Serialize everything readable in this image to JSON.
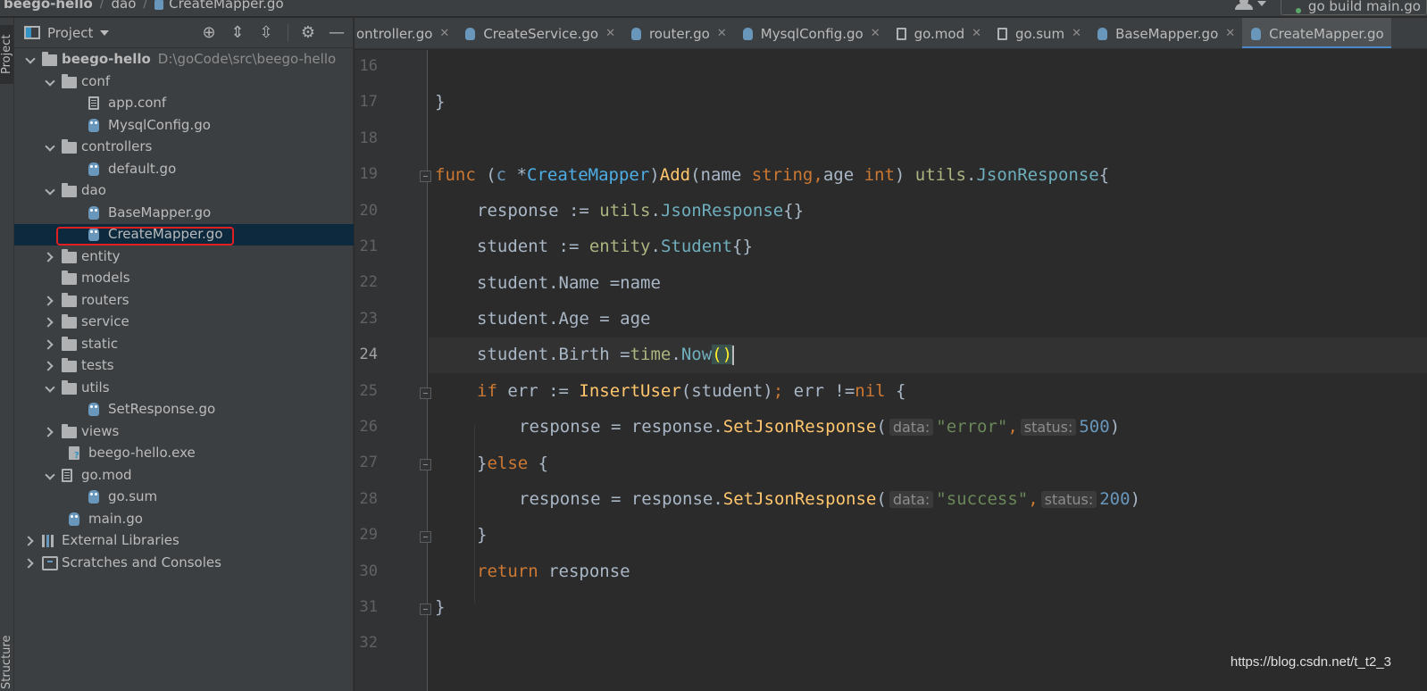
{
  "breadcrumb": {
    "project": "beego-hello",
    "folder": "dao",
    "file": "CreateMapper.go"
  },
  "run_config": "go build main.go",
  "sidebar_tabs": {
    "project": "Project",
    "structure": "Structure"
  },
  "project_panel": {
    "title": "Project",
    "tree": [
      {
        "label": "beego-hello",
        "path": "D:\\goCode\\src\\beego-hello",
        "type": "folder",
        "depth": 0,
        "state": "open",
        "bold": true
      },
      {
        "label": "conf",
        "type": "folder",
        "depth": 1,
        "state": "open"
      },
      {
        "label": "app.conf",
        "type": "txt",
        "depth": 2
      },
      {
        "label": "MysqlConfig.go",
        "type": "go",
        "depth": 2
      },
      {
        "label": "controllers",
        "type": "folder",
        "depth": 1,
        "state": "open"
      },
      {
        "label": "default.go",
        "type": "go",
        "depth": 2
      },
      {
        "label": "dao",
        "type": "folder",
        "depth": 1,
        "state": "open"
      },
      {
        "label": "BaseMapper.go",
        "type": "go",
        "depth": 2
      },
      {
        "label": "CreateMapper.go",
        "type": "go",
        "depth": 2,
        "selected": true
      },
      {
        "label": "entity",
        "type": "folder",
        "depth": 1,
        "state": "closed"
      },
      {
        "label": "models",
        "type": "folder",
        "depth": 1,
        "state": "none"
      },
      {
        "label": "routers",
        "type": "folder",
        "depth": 1,
        "state": "closed"
      },
      {
        "label": "service",
        "type": "folder",
        "depth": 1,
        "state": "closed"
      },
      {
        "label": "static",
        "type": "folder",
        "depth": 1,
        "state": "closed"
      },
      {
        "label": "tests",
        "type": "folder",
        "depth": 1,
        "state": "closed"
      },
      {
        "label": "utils",
        "type": "folder",
        "depth": 1,
        "state": "open"
      },
      {
        "label": "SetResponse.go",
        "type": "go",
        "depth": 2
      },
      {
        "label": "views",
        "type": "folder",
        "depth": 1,
        "state": "closed"
      },
      {
        "label": "beego-hello.exe",
        "type": "exe",
        "depth": 1
      },
      {
        "label": "go.mod",
        "type": "txt",
        "depth": 1,
        "state": "open"
      },
      {
        "label": "go.sum",
        "type": "go",
        "depth": 2
      },
      {
        "label": "main.go",
        "type": "go",
        "depth": 1
      },
      {
        "label": "External Libraries",
        "type": "lib",
        "depth": 0,
        "state": "closed"
      },
      {
        "label": "Scratches and Consoles",
        "type": "scratch",
        "depth": 0,
        "state": "closed"
      }
    ]
  },
  "tabs": [
    {
      "label": "ontroller.go",
      "type": "go"
    },
    {
      "label": "CreateService.go",
      "type": "go"
    },
    {
      "label": "router.go",
      "type": "go"
    },
    {
      "label": "MysqlConfig.go",
      "type": "go"
    },
    {
      "label": "go.mod",
      "type": "txt"
    },
    {
      "label": "go.sum",
      "type": "txt"
    },
    {
      "label": "BaseMapper.go",
      "type": "go"
    },
    {
      "label": "CreateMapper.go",
      "type": "go",
      "active": true
    }
  ],
  "editor": {
    "line_numbers": [
      "16",
      "17",
      "18",
      "19",
      "20",
      "21",
      "22",
      "23",
      "24",
      "25",
      "26",
      "27",
      "28",
      "29",
      "30",
      "31",
      "32"
    ],
    "current_line": "24",
    "hints": {
      "data": "data:",
      "status": "status:"
    },
    "code": {
      "l17": "}",
      "l19_func": "func",
      "l19_recv_open": "(",
      "l19_recv_c": "c",
      "l19_star": " *",
      "l19_type": "CreateMapper",
      "l19_close": ")",
      "l19_name": "Add",
      "l19_params_a": "(name ",
      "l19_string": "string",
      "l19_comma": ",",
      "l19_age": "age ",
      "l19_int": "int",
      "l19_params_b": ") ",
      "l19_pkg": "utils",
      "l19_dot": ".",
      "l19_ret": "JsonResponse",
      "l19_brace": "{",
      "l20_a": "response := ",
      "l20_pkg": "utils",
      "l20_dot": ".",
      "l20_type": "JsonResponse",
      "l20_b": "{}",
      "l21_a": "student := ",
      "l21_pkg": "entity",
      "l21_dot": ".",
      "l21_type": "Student",
      "l21_b": "{}",
      "l22": "student.Name =name",
      "l23": "student.Age = age",
      "l24_a": "student.Birth =",
      "l24_pkg": "time",
      "l24_dot": ".",
      "l24_fn": "Now",
      "l24_paren": "()",
      "l25_if": "if",
      "l25_a": " err := ",
      "l25_fn": "InsertUser",
      "l25_b": "(student)",
      "l25_semi": ";",
      "l25_c": " err !=",
      "l25_nil": "nil",
      "l25_d": " {",
      "l26_a": "response = response.",
      "l26_fn": "SetJsonResponse",
      "l26_open": "(",
      "l26_str": "\"error\"",
      "l26_comma": ",",
      "l26_num": "500",
      "l26_close": ")",
      "l27_a": "}",
      "l27_else": "else",
      "l27_b": " {",
      "l28_a": "response = response.",
      "l28_fn": "SetJsonResponse",
      "l28_open": "(",
      "l28_str": "\"success\"",
      "l28_comma": ",",
      "l28_num": "200",
      "l28_close": ")",
      "l29": "}",
      "l30_kw": "return",
      "l30_b": " response",
      "l31": "}"
    }
  },
  "watermark": "https://blog.csdn.net/t_t2_3"
}
